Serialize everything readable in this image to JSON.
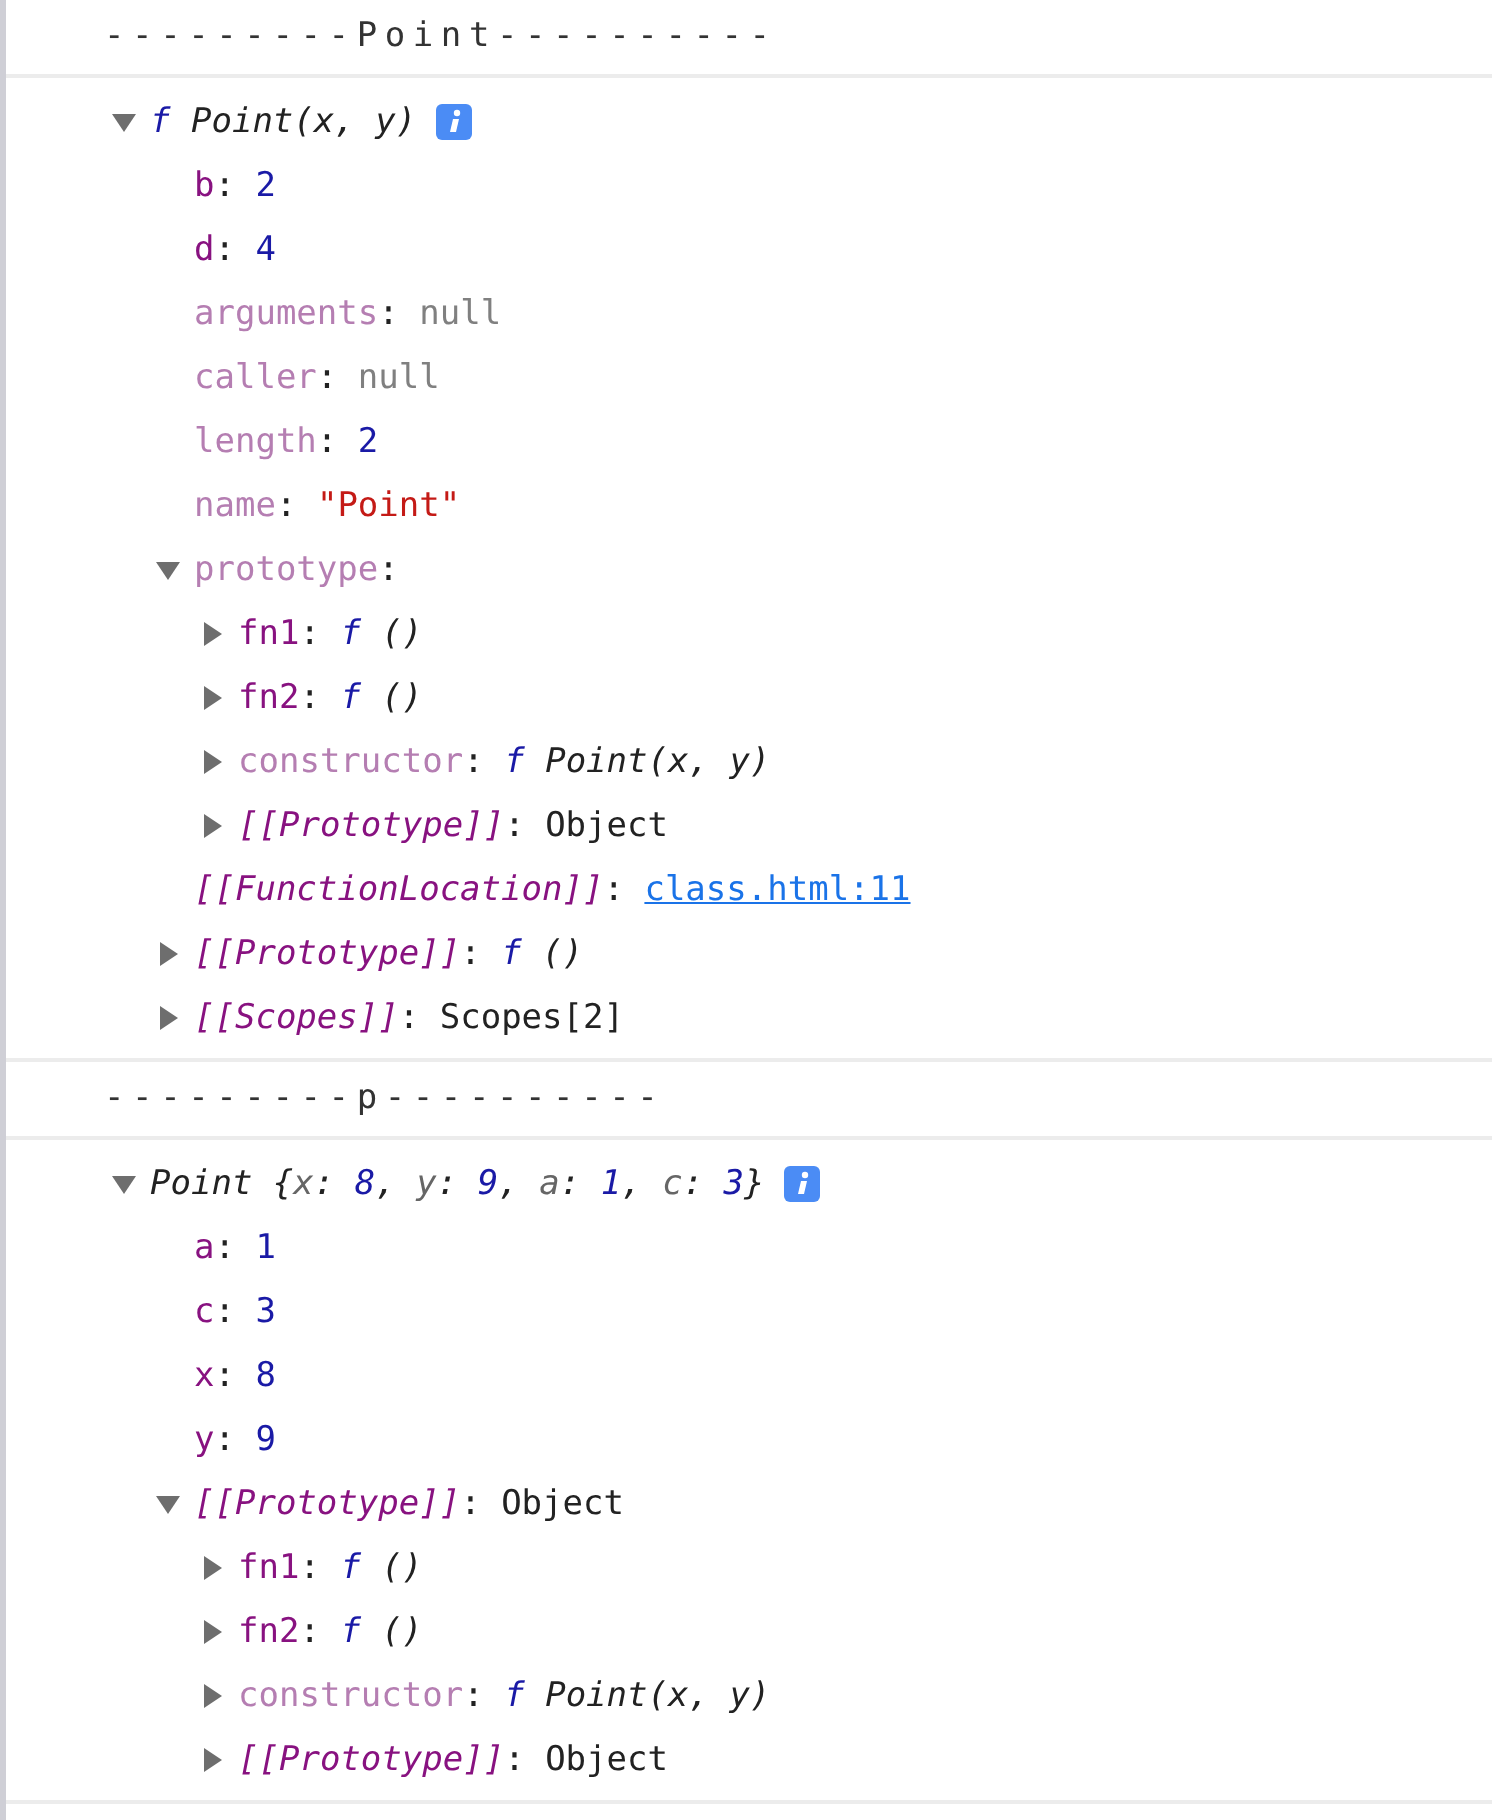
{
  "console": [
    {
      "kind": "log",
      "text": "---------Point----------"
    },
    {
      "kind": "tree",
      "expanded": true,
      "summary": [
        {
          "text": "f",
          "kind": "fn"
        },
        {
          "text": " Point(x, y)",
          "kind": "name"
        }
      ],
      "children": [
        {
          "kind": "leaf",
          "key": {
            "text": "b",
            "kind": "own"
          },
          "colon": ":",
          "value": {
            "text": "2",
            "kind": "number"
          }
        },
        {
          "kind": "leaf",
          "key": {
            "text": "d",
            "kind": "own"
          },
          "colon": ":",
          "value": {
            "text": "4",
            "kind": "number"
          }
        },
        {
          "kind": "leaf",
          "key": {
            "text": "arguments",
            "kind": "dim"
          },
          "colon": ":",
          "value": {
            "text": "null",
            "kind": "null"
          }
        },
        {
          "kind": "leaf",
          "key": {
            "text": "caller",
            "kind": "dim"
          },
          "colon": ":",
          "value": {
            "text": "null",
            "kind": "null"
          }
        },
        {
          "kind": "leaf",
          "key": {
            "text": "length",
            "kind": "dim"
          },
          "colon": ":",
          "value": {
            "text": "2",
            "kind": "number"
          }
        },
        {
          "kind": "leaf",
          "key": {
            "text": "name",
            "kind": "dim"
          },
          "colon": ":",
          "value": {
            "text": "\"Point\"",
            "kind": "string"
          }
        },
        {
          "kind": "branch",
          "expanded": true,
          "key": {
            "text": "prototype",
            "kind": "dim"
          },
          "colon": ":",
          "children": [
            {
              "kind": "branch",
              "expanded": false,
              "key": {
                "text": "fn1",
                "kind": "own"
              },
              "colon": ":",
              "fn": "f",
              "value": {
                "text": " ()",
                "kind": "function"
              }
            },
            {
              "kind": "branch",
              "expanded": false,
              "key": {
                "text": "fn2",
                "kind": "own"
              },
              "colon": ":",
              "fn": "f",
              "value": {
                "text": " ()",
                "kind": "function"
              }
            },
            {
              "kind": "branch",
              "expanded": false,
              "key": {
                "text": "constructor",
                "kind": "dim"
              },
              "colon": ":",
              "fn": "f",
              "value": {
                "text": " Point(x, y)",
                "kind": "function"
              }
            },
            {
              "kind": "branch",
              "expanded": false,
              "key": {
                "text": "[[Prototype]]",
                "kind": "internal"
              },
              "colon": ":",
              "value": {
                "text": "Object",
                "kind": "object"
              }
            }
          ]
        },
        {
          "kind": "leaf",
          "key": {
            "text": "[[FunctionLocation]]",
            "kind": "internal"
          },
          "colon": ":",
          "value": {
            "text": "class.html:11",
            "kind": "link"
          }
        },
        {
          "kind": "branch",
          "expanded": false,
          "key": {
            "text": "[[Prototype]]",
            "kind": "internal"
          },
          "colon": ":",
          "fn": "f",
          "value": {
            "text": " ()",
            "kind": "function"
          }
        },
        {
          "kind": "branch",
          "expanded": false,
          "key": {
            "text": "[[Scopes]]",
            "kind": "internal"
          },
          "colon": ":",
          "value": {
            "text": "Scopes[2]",
            "kind": "object"
          }
        }
      ]
    },
    {
      "kind": "log",
      "text": "---------p----------"
    },
    {
      "kind": "tree",
      "expanded": true,
      "summary": [
        {
          "text": "Point {",
          "kind": "name"
        },
        {
          "text": "x",
          "kind": "pkey"
        },
        {
          "text": ": ",
          "kind": "name"
        },
        {
          "text": "8",
          "kind": "num"
        },
        {
          "text": ", ",
          "kind": "name"
        },
        {
          "text": "y",
          "kind": "pkey"
        },
        {
          "text": ": ",
          "kind": "name"
        },
        {
          "text": "9",
          "kind": "num"
        },
        {
          "text": ", ",
          "kind": "name"
        },
        {
          "text": "a",
          "kind": "pkey"
        },
        {
          "text": ": ",
          "kind": "name"
        },
        {
          "text": "1",
          "kind": "num"
        },
        {
          "text": ", ",
          "kind": "name"
        },
        {
          "text": "c",
          "kind": "pkey"
        },
        {
          "text": ": ",
          "kind": "name"
        },
        {
          "text": "3",
          "kind": "num"
        },
        {
          "text": "}",
          "kind": "name"
        }
      ],
      "children": [
        {
          "kind": "leaf",
          "key": {
            "text": "a",
            "kind": "own"
          },
          "colon": ":",
          "value": {
            "text": "1",
            "kind": "number"
          }
        },
        {
          "kind": "leaf",
          "key": {
            "text": "c",
            "kind": "own"
          },
          "colon": ":",
          "value": {
            "text": "3",
            "kind": "number"
          }
        },
        {
          "kind": "leaf",
          "key": {
            "text": "x",
            "kind": "own"
          },
          "colon": ":",
          "value": {
            "text": "8",
            "kind": "number"
          }
        },
        {
          "kind": "leaf",
          "key": {
            "text": "y",
            "kind": "own"
          },
          "colon": ":",
          "value": {
            "text": "9",
            "kind": "number"
          }
        },
        {
          "kind": "branch",
          "expanded": true,
          "key": {
            "text": "[[Prototype]]",
            "kind": "internal"
          },
          "colon": ":",
          "value": {
            "text": "Object",
            "kind": "object"
          },
          "children": [
            {
              "kind": "branch",
              "expanded": false,
              "key": {
                "text": "fn1",
                "kind": "own"
              },
              "colon": ":",
              "fn": "f",
              "value": {
                "text": " ()",
                "kind": "function"
              }
            },
            {
              "kind": "branch",
              "expanded": false,
              "key": {
                "text": "fn2",
                "kind": "own"
              },
              "colon": ":",
              "fn": "f",
              "value": {
                "text": " ()",
                "kind": "function"
              }
            },
            {
              "kind": "branch",
              "expanded": false,
              "key": {
                "text": "constructor",
                "kind": "dim"
              },
              "colon": ":",
              "fn": "f",
              "value": {
                "text": " Point(x, y)",
                "kind": "function"
              }
            },
            {
              "kind": "branch",
              "expanded": false,
              "key": {
                "text": "[[Prototype]]",
                "kind": "internal"
              },
              "colon": ":",
              "value": {
                "text": "Object",
                "kind": "object"
              }
            }
          ]
        }
      ]
    }
  ]
}
